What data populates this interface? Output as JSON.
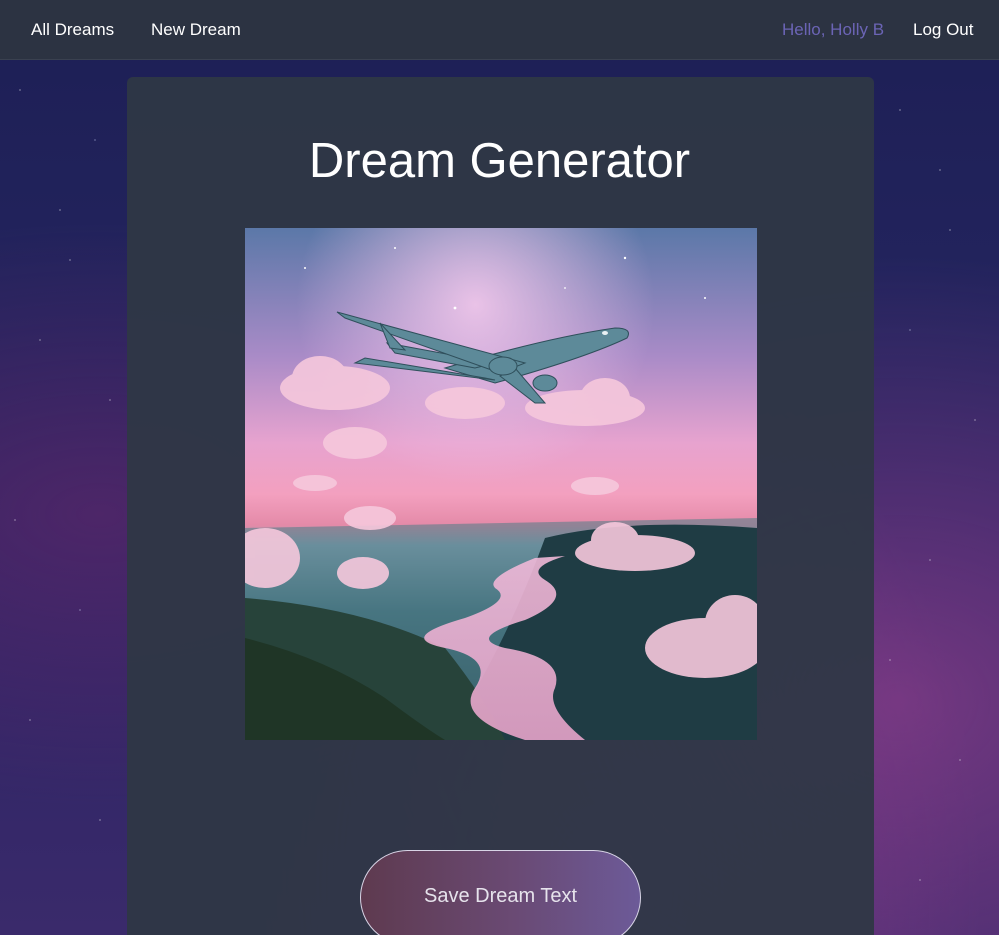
{
  "nav": {
    "all_dreams": "All Dreams",
    "new_dream": "New Dream",
    "greeting": "Hello, Holly B",
    "logout": "Log Out"
  },
  "main": {
    "title": "Dream Generator",
    "image_alt": "",
    "save_button": "Save Dream Text"
  },
  "colors": {
    "navbar_bg": "#2c3342",
    "card_bg": "#2f3745",
    "greeting_text": "#6b64b5",
    "button_gradient_start": "#5e3a4f",
    "button_gradient_end": "#6c5a98"
  }
}
